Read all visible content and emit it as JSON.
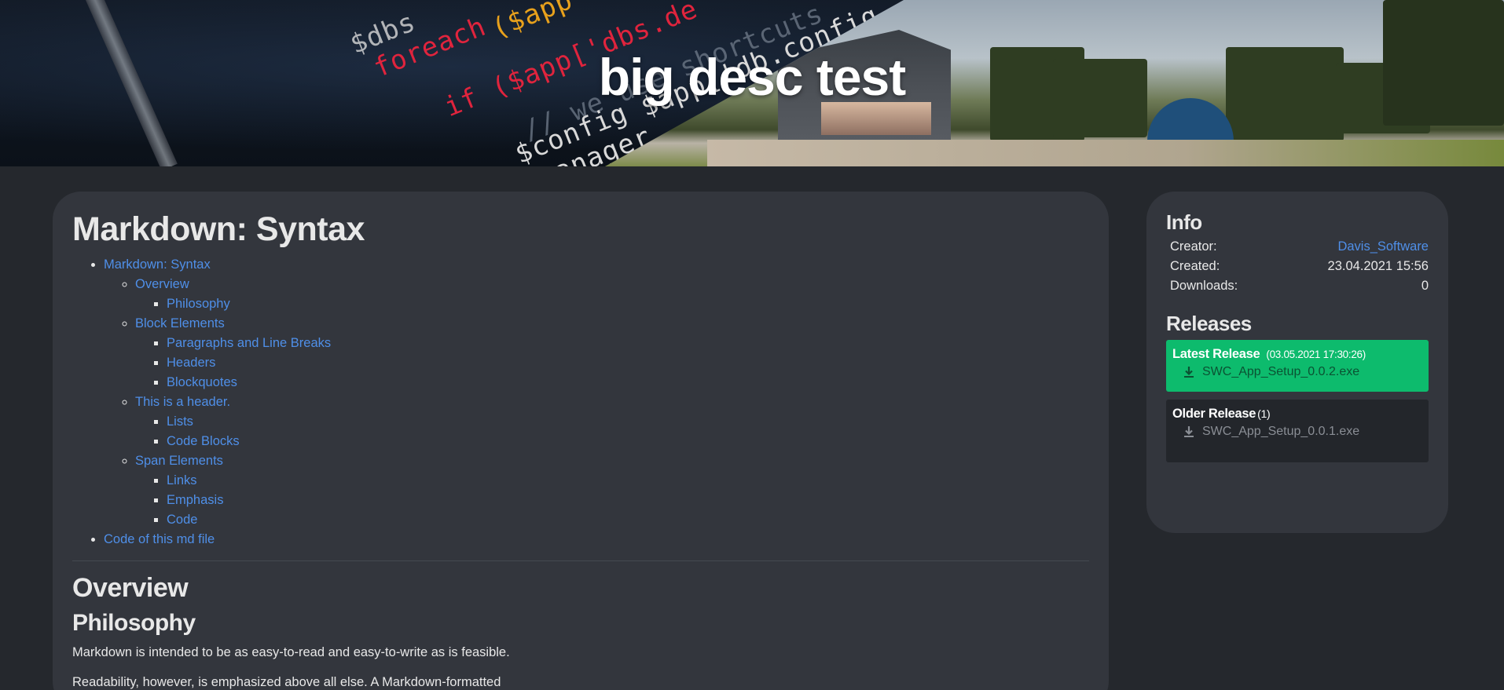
{
  "banner": {
    "title": "big desc test"
  },
  "main": {
    "title": "Markdown: Syntax",
    "toc": [
      {
        "label": "Markdown: Syntax",
        "children": [
          {
            "label": "Overview",
            "children": [
              {
                "label": "Philosophy"
              }
            ]
          },
          {
            "label": "Block Elements",
            "children": [
              {
                "label": "Paragraphs and Line Breaks"
              },
              {
                "label": "Headers"
              },
              {
                "label": "Blockquotes"
              }
            ]
          },
          {
            "label": "This is a header.",
            "children": [
              {
                "label": "Lists"
              },
              {
                "label": "Code Blocks"
              }
            ]
          },
          {
            "label": "Span Elements",
            "children": [
              {
                "label": "Links"
              },
              {
                "label": "Emphasis"
              },
              {
                "label": "Code"
              }
            ]
          }
        ]
      },
      {
        "label": "Code of this md file"
      }
    ],
    "overview_heading": "Overview",
    "philosophy_heading": "Philosophy",
    "paragraph_1": "Markdown is intended to be as easy-to-read and easy-to-write as is feasible.",
    "paragraph_2": "Readability, however, is emphasized above all else. A Markdown-formatted"
  },
  "info": {
    "heading": "Info",
    "creator_label": "Creator:",
    "creator_value": "Davis_Software",
    "created_label": "Created:",
    "created_value": "23.04.2021 15:56",
    "downloads_label": "Downloads:",
    "downloads_value": "0"
  },
  "releases": {
    "heading": "Releases",
    "latest": {
      "label": "Latest Release",
      "date": "(03.05.2021 17:30:26)",
      "file": "SWC_App_Setup_0.0.2.exe"
    },
    "older": {
      "label": "Older Release",
      "count": "(1)",
      "file": "SWC_App_Setup_0.0.1.exe"
    }
  },
  "colors": {
    "background": "#25282d",
    "card": "#33363d",
    "link": "#4f8fe8",
    "latest_release": "#0dbb6d",
    "older_release": "#23262b"
  }
}
